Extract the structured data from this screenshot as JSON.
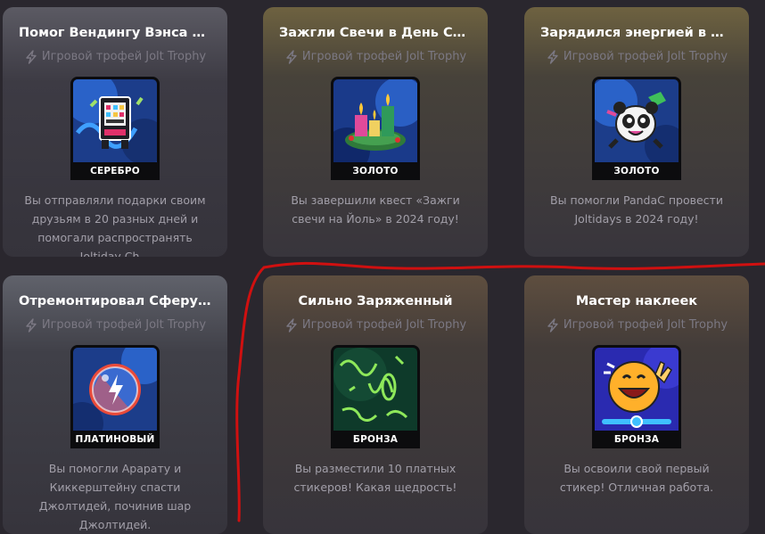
{
  "cards": [
    {
      "title": "Помог Вендингу Вэнса Раз...",
      "subtitle": "Игровой трофей Jolt Trophy",
      "rank": "СЕРЕБРО",
      "desc": "Вы отправляли подарки своим друзьям в 20 разных дней и помогали распространять Joltiday Ch...",
      "art": "vending-machine-art"
    },
    {
      "title": "Зажгли Свечи в День Свят...",
      "subtitle": "Игровой трофей Jolt Trophy",
      "rank": "ЗОЛОТО",
      "desc": "Вы завершили квест «Зажги свечи на Йоль» в 2024 году!",
      "art": "candles-art"
    },
    {
      "title": "Зарядился энергией в дни...",
      "subtitle": "Игровой трофей Jolt Trophy",
      "rank": "ЗОЛОТО",
      "desc": "Вы помогли PandaC провести Joltidays в 2024 году!",
      "art": "panda-art"
    },
    {
      "title": "Отремонтировал Сферу Д...",
      "subtitle": "Игровой трофей Jolt Trophy",
      "rank": "ПЛАТИНОВЫЙ",
      "desc": "Вы помогли Арарату и Киккерштейну спасти Джолтидей, починив шар Джолтидей.",
      "art": "orb-art"
    },
    {
      "title": "Сильно Заряженный",
      "subtitle": "Игровой трофей Jolt Trophy",
      "rank": "БРОНЗА",
      "desc": "Вы разместили 10 платных стикеров! Какая щедрость!",
      "art": "scribble-art"
    },
    {
      "title": "Мастер наклеек",
      "subtitle": "Игровой трофей Jolt Trophy",
      "rank": "БРОНЗА",
      "desc": "Вы освоили свой первый стикер! Отличная работа.",
      "art": "smiley-art"
    }
  ],
  "colors": {
    "background": "#2a272e",
    "title": "#ffffff",
    "subtitle": "#7b7883",
    "desc": "#a29fa9",
    "annotation": "#d01010"
  }
}
